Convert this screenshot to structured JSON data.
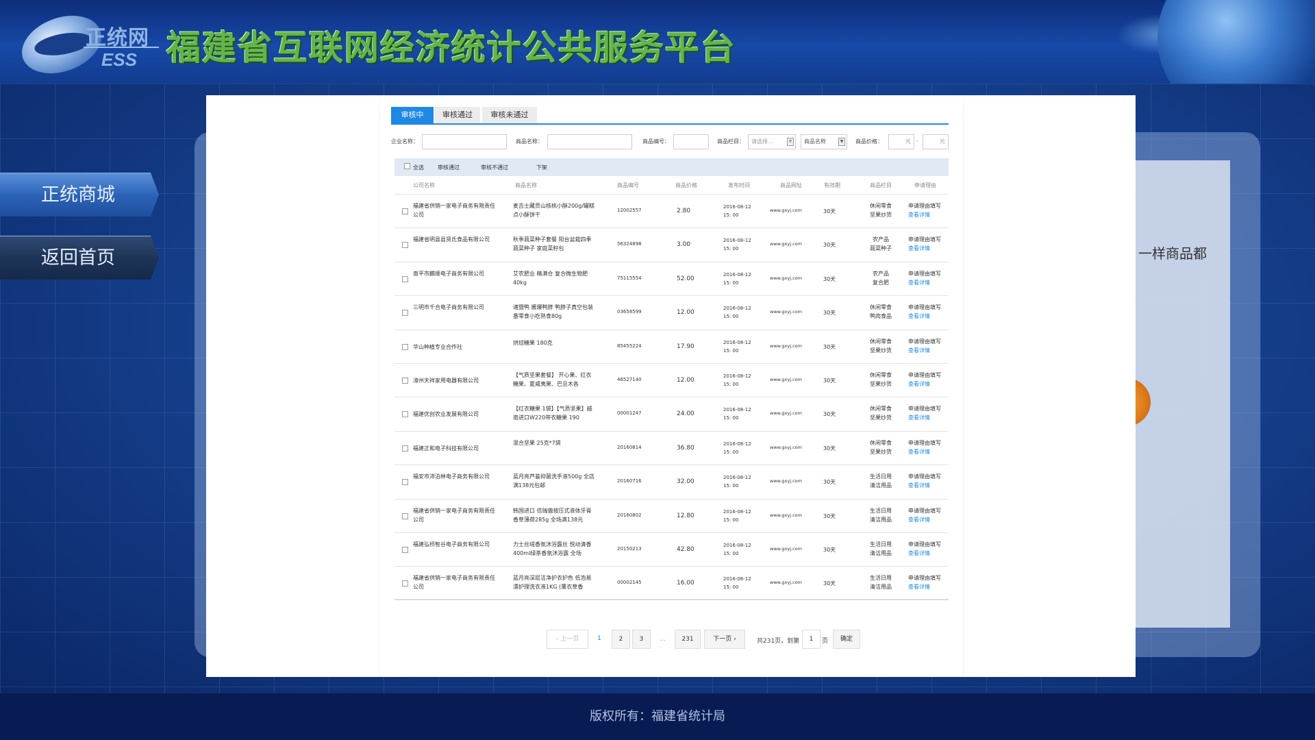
{
  "header": {
    "logo_top": "正统网",
    "logo_bottom": "ESS",
    "title": "福建省互联网经济统计公共服务平台"
  },
  "nav": {
    "items": [
      "正统商城",
      "返回首页"
    ]
  },
  "background_panel": {
    "text": "一样商品都"
  },
  "tabs": [
    "审核中",
    "审核通过",
    "审核未通过"
  ],
  "filters": {
    "company_label": "企业名称：",
    "product_label": "商品名称：",
    "code_label": "商品编号：",
    "column_label": "商品栏目：",
    "column_placeholder": "请选择...",
    "name_select": "商品名称",
    "price_label": "商品价格：",
    "price_unit": "元",
    "price_sep": "-"
  },
  "toolbar": {
    "select_all": "全选",
    "approve": "审核通过",
    "reject": "审核不通过",
    "offline": "下架"
  },
  "table": {
    "headers": [
      "公司名称",
      "商品名称",
      "商品编号",
      "商品价格",
      "发布时间",
      "商品网址",
      "有效期",
      "商品栏目",
      "申请理由"
    ],
    "rows": [
      {
        "company": "福建省供销一家电子商务有限责任公司",
        "name": "麦吉士藏贡山核桃小酥200g/罐糕点小酥饼干",
        "code": "12002557",
        "price": "2.80",
        "date": "2016-08-12",
        "time": "15: 00",
        "url": "www.gxyj.com",
        "valid": "30天",
        "cat1": "休闲零食",
        "cat2": "坚果炒货",
        "reason": "申请理由填写",
        "detail": "查看详情"
      },
      {
        "company": "福建省明县县贤氏食品有限公司",
        "name": "秋季蔬菜种子套餐 阳台盆栽四季蔬菜种子 家庭菜籽包",
        "code": "56324898",
        "price": "3.00",
        "date": "2016-08-12",
        "time": "15: 00",
        "url": "www.gxyj.com",
        "valid": "30天",
        "cat1": "农产品",
        "cat2": "蔬菜种子",
        "reason": "申请理由填写",
        "detail": "查看详情"
      },
      {
        "company": "南平市麟顺电子商务有限公司",
        "name": "艾农肥业 精满仓 复合微生物肥40kg",
        "code": "75115554",
        "price": "52.00",
        "date": "2016-08-12",
        "time": "15: 00",
        "url": "www.gxyj.com",
        "valid": "30天",
        "cat1": "农产品",
        "cat2": "复合肥",
        "reason": "申请理由填写",
        "detail": "查看详情"
      },
      {
        "company": "三明市千合电子商务有限公司",
        "name": "诸暨鸭 酱爆鸭脖 鸭脖子真空包装番零食小吃熟食80g",
        "code": "03658599",
        "price": "12.00",
        "date": "2016-08-12",
        "time": "15: 00",
        "url": "www.gxyj.com",
        "valid": "30天",
        "cat1": "休闲零食",
        "cat2": "鸭肉食品",
        "reason": "申请理由填写",
        "detail": "查看详情"
      },
      {
        "company": "华山种植专业合作社",
        "name": "烘焙糖果 180克",
        "code": "85455224",
        "price": "17.90",
        "date": "2016-08-12",
        "time": "15: 00",
        "url": "www.gxyj.com",
        "valid": "30天",
        "cat1": "休闲零食",
        "cat2": "坚果炒货",
        "reason": "申请理由填写",
        "detail": "查看详情"
      },
      {
        "company": "漳州天祥家用电器有限公司",
        "name": "【气质坚果套餐】 开心果、红衣糖果、夏威夷果、巴旦木各",
        "code": "46527140",
        "price": "12.00",
        "date": "2016-08-12",
        "time": "15: 00",
        "url": "www.gxyj.com",
        "valid": "30天",
        "cat1": "休闲零食",
        "cat2": "坚果炒货",
        "reason": "申请理由填写",
        "detail": "查看详情"
      },
      {
        "company": "福建优创农业发展有限公司",
        "name": "【红衣糖果 1袋】【气质坚果】越南进口W220带衣糖果 190",
        "code": "00001247",
        "price": "24.00",
        "date": "2016-08-12",
        "time": "15: 00",
        "url": "www.gxyj.com",
        "valid": "30天",
        "cat1": "休闲零食",
        "cat2": "坚果炒货",
        "reason": "申请理由填写",
        "detail": "查看详情"
      },
      {
        "company": "福建正和电子科技有限公司",
        "name": "混合坚果 25克*7袋",
        "code": "20160814",
        "price": "36.80",
        "date": "2016-08-12",
        "time": "15: 00",
        "url": "www.gxyj.com",
        "valid": "30天",
        "cat1": "休闲零食",
        "cat2": "坚果炒货",
        "reason": "申请理由填写",
        "detail": "查看详情"
      },
      {
        "company": "福安市沛泊林电子商务有限公司",
        "name": "蓝月亮芦荟抑菌洗手液500g 全店满138元包邮",
        "code": "20160716",
        "price": "32.00",
        "date": "2016-08-12",
        "time": "15: 00",
        "url": "www.gxyj.com",
        "valid": "30天",
        "cat1": "生活日用",
        "cat2": "清洁用品",
        "reason": "申请理由填写",
        "detail": "查看详情"
      },
      {
        "company": "福建省供销一家电子商务有限责任公司",
        "name": "韩国进口 倍瑞傲按压式液体牙膏 香草薄荷285g 全场满138元",
        "code": "20160802",
        "price": "12.80",
        "date": "2016-08-12",
        "time": "15: 00",
        "url": "www.gxyj.com",
        "valid": "30天",
        "cat1": "生活日用",
        "cat2": "清洁用品",
        "reason": "申请理由填写",
        "detail": "查看详情"
      },
      {
        "company": "福建弘桥智谷电子商务有限公司",
        "name": "力士丝绒香氛沐浴露丝 悦动清香400ml绿茶香氛沐浴露 全场",
        "code": "20150213",
        "price": "42.80",
        "date": "2016-08-12",
        "time": "15: 00",
        "url": "www.gxyj.com",
        "valid": "30天",
        "cat1": "生活日用",
        "cat2": "清洁用品",
        "reason": "申请理由填写",
        "detail": "查看详情"
      },
      {
        "company": "福建省供销一家电子商务有限责任公司",
        "name": "蓝月亮深层洁净护衣护色 低泡易漂护理洗衣液1KG (薰衣草香",
        "code": "00002145",
        "price": "16.00",
        "date": "2016-08-12",
        "time": "15: 00",
        "url": "www.gxyj.com",
        "valid": "30天",
        "cat1": "生活日用",
        "cat2": "清洁用品",
        "reason": "申请理由填写",
        "detail": "查看详情"
      }
    ]
  },
  "pagination": {
    "prev": "‹ 上一页",
    "pages": [
      "1",
      "2",
      "3"
    ],
    "ellipsis": "…",
    "last": "231",
    "next": "下一页 ›",
    "total": "共231页，到第",
    "page_input": "1",
    "page_unit": "页",
    "confirm": "确定"
  },
  "footer": {
    "copyright": "版权所有：福建省统计局"
  }
}
